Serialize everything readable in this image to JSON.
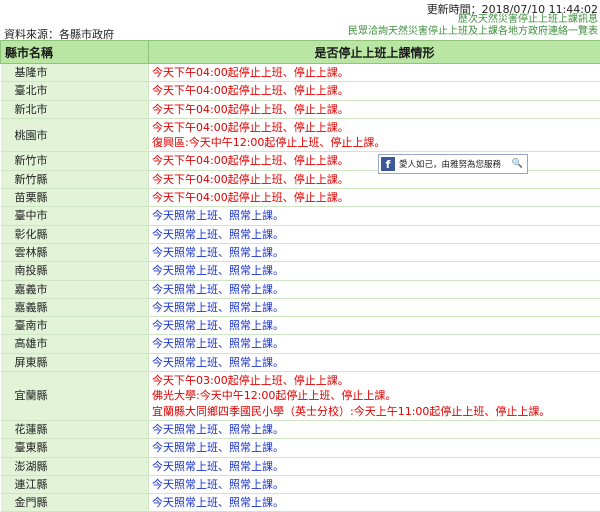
{
  "header": {
    "update_time": "更新時間：2018/07/10 11:44:02",
    "link_history": "歷次天然災害停止上班上課訊息",
    "link_guide": "民眾洽詢天然災害停止上班及上課各地方政府連絡一覽表",
    "source": "資料來源：各縣市政府"
  },
  "table": {
    "col_county": "縣市名稱",
    "col_status": "是否停止上班上課情形",
    "rows": [
      {
        "name": "基隆市",
        "lines": [
          {
            "text": "今天下午04:00起停止上班、停止上課。",
            "color": "red"
          }
        ]
      },
      {
        "name": "臺北市",
        "lines": [
          {
            "text": "今天下午04:00起停止上班、停止上課。",
            "color": "red"
          }
        ]
      },
      {
        "name": "新北市",
        "lines": [
          {
            "text": "今天下午04:00起停止上班、停止上課。",
            "color": "red"
          }
        ]
      },
      {
        "name": "桃園市",
        "lines": [
          {
            "text": "今天下午04:00起停止上班、停止上課。",
            "color": "red"
          },
          {
            "text": "復興區:今天中午12:00起停止上班、停止上課。",
            "color": "red"
          }
        ]
      },
      {
        "name": "新竹市",
        "lines": [
          {
            "text": "今天下午04:00起停止上班、停止上課。",
            "color": "red"
          }
        ]
      },
      {
        "name": "新竹縣",
        "lines": [
          {
            "text": "今天下午04:00起停止上班、停止上課。",
            "color": "red"
          }
        ]
      },
      {
        "name": "苗栗縣",
        "lines": [
          {
            "text": "今天下午04:00起停止上班、停止上課。",
            "color": "red"
          }
        ]
      },
      {
        "name": "臺中市",
        "lines": [
          {
            "text": "今天照常上班、照常上課。",
            "color": "blue"
          }
        ]
      },
      {
        "name": "彰化縣",
        "lines": [
          {
            "text": "今天照常上班、照常上課。",
            "color": "blue"
          }
        ]
      },
      {
        "name": "雲林縣",
        "lines": [
          {
            "text": "今天照常上班、照常上課。",
            "color": "blue"
          }
        ]
      },
      {
        "name": "南投縣",
        "lines": [
          {
            "text": "今天照常上班、照常上課。",
            "color": "blue"
          }
        ]
      },
      {
        "name": "嘉義市",
        "lines": [
          {
            "text": "今天照常上班、照常上課。",
            "color": "blue"
          }
        ]
      },
      {
        "name": "嘉義縣",
        "lines": [
          {
            "text": "今天照常上班、照常上課。",
            "color": "blue"
          }
        ]
      },
      {
        "name": "臺南市",
        "lines": [
          {
            "text": "今天照常上班、照常上課。",
            "color": "blue"
          }
        ]
      },
      {
        "name": "高雄市",
        "lines": [
          {
            "text": "今天照常上班、照常上課。",
            "color": "blue"
          }
        ]
      },
      {
        "name": "屏東縣",
        "lines": [
          {
            "text": "今天照常上班、照常上課。",
            "color": "blue"
          }
        ]
      },
      {
        "name": "宜蘭縣",
        "lines": [
          {
            "text": "今天下午03:00起停止上班、停止上課。",
            "color": "red"
          },
          {
            "text": "佛光大學:今天中午12:00起停止上班、停止上課。",
            "color": "red"
          },
          {
            "text": "宜蘭縣大同鄉四季國民小學（英士分校）:今天上午11:00起停止上班、停止上課。",
            "color": "red"
          }
        ]
      },
      {
        "name": "花蓮縣",
        "lines": [
          {
            "text": "今天照常上班、照常上課。",
            "color": "blue"
          }
        ]
      },
      {
        "name": "臺東縣",
        "lines": [
          {
            "text": "今天照常上班、照常上課。",
            "color": "blue"
          }
        ]
      },
      {
        "name": "澎湖縣",
        "lines": [
          {
            "text": "今天照常上班、照常上課。",
            "color": "blue"
          }
        ]
      },
      {
        "name": "連江縣",
        "lines": [
          {
            "text": "今天照常上班、照常上課。",
            "color": "blue"
          }
        ]
      },
      {
        "name": "金門縣",
        "lines": [
          {
            "text": "今天照常上班、照常上課。",
            "color": "blue"
          }
        ]
      }
    ]
  },
  "fb_widget": {
    "icon": "facebook-icon",
    "text": "愛人如己，由雅努為您服務",
    "search_icon": "magnifier-icon"
  }
}
